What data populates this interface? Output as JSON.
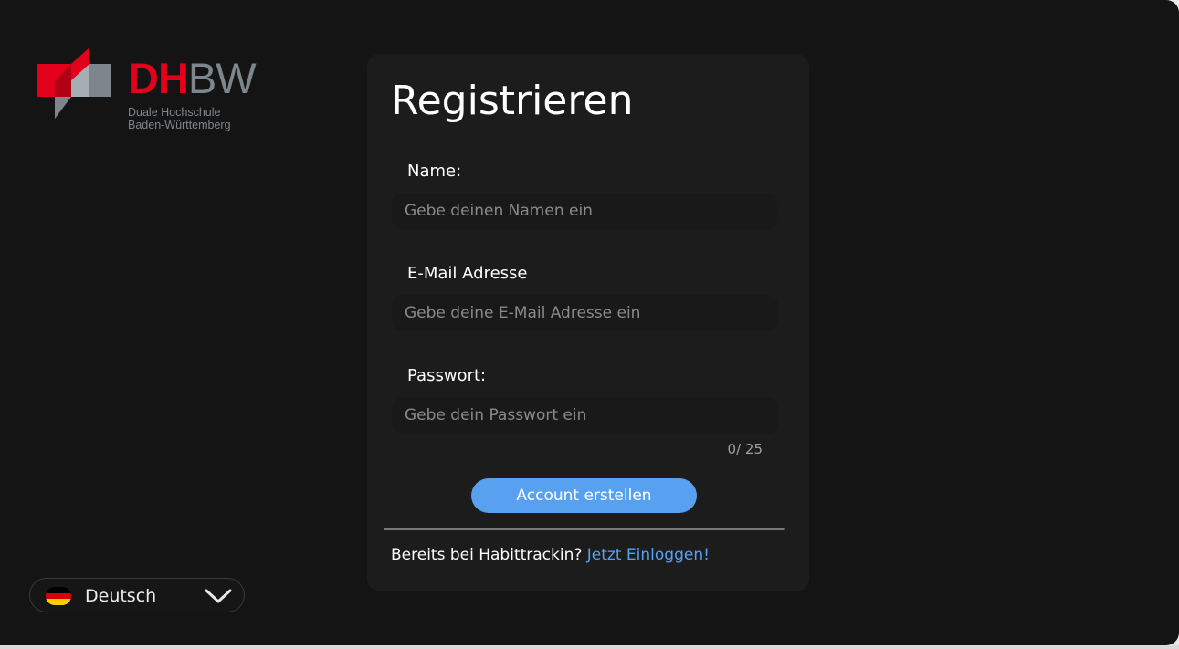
{
  "logo": {
    "wordmark_dh": "DH",
    "wordmark_bw": "BW",
    "subtitle_line1": "Duale Hochschule",
    "subtitle_line2": "Baden-Württemberg",
    "colors": {
      "red": "#e2001a",
      "grey": "#7d868c"
    }
  },
  "language": {
    "selected": "Deutsch",
    "flag_icon": "german-flag-icon",
    "chevron_icon": "chevron-down-icon"
  },
  "form": {
    "title": "Registrieren",
    "name_label": "Name:",
    "name_placeholder": "Gebe deinen Namen ein",
    "name_value": "",
    "email_label": "E-Mail Adresse",
    "email_placeholder": "Gebe deine E-Mail Adresse ein",
    "email_value": "",
    "password_label": "Passwort:",
    "password_placeholder": "Gebe dein Passwort ein",
    "password_value": "",
    "password_counter": "0/ 25",
    "submit_label": "Account erstellen",
    "footer_text": "Bereits bei Habittrackin?",
    "login_link": "Jetzt Einloggen!"
  },
  "colors": {
    "background": "#141414",
    "card": "#1c1c1c",
    "accent": "#58a1f0"
  }
}
